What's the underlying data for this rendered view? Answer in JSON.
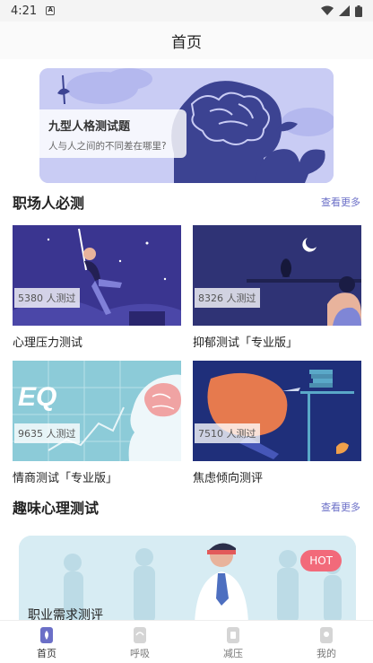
{
  "status_bar": {
    "time": "4:21"
  },
  "header": {
    "title": "首页"
  },
  "banner": {
    "title": "九型人格测试题",
    "subtitle": "人与人之间的不同差在哪里?"
  },
  "section_workplace": {
    "title": "职场人必测",
    "more": "查看更多",
    "cards": [
      {
        "count": "5380 人测过",
        "title": "心理压力测试"
      },
      {
        "count": "8326 人测过",
        "title": "抑郁测试「专业版」"
      },
      {
        "count": "9635 人测过",
        "title": "情商测试「专业版」"
      },
      {
        "count": "7510 人测过",
        "title": "焦虑倾向测评"
      }
    ]
  },
  "section_fun": {
    "title": "趣味心理测试",
    "more": "查看更多",
    "promo": {
      "badge": "HOT",
      "title": "职业需求测评"
    }
  },
  "bottom_nav": [
    {
      "label": "首页",
      "icon": "home-icon"
    },
    {
      "label": "呼吸",
      "icon": "breath-icon"
    },
    {
      "label": "减压",
      "icon": "relax-icon"
    },
    {
      "label": "我的",
      "icon": "profile-icon"
    }
  ],
  "colors": {
    "accent": "#6b6fc7",
    "hot": "#f26a7a",
    "banner_bg": "#c9ccf4"
  }
}
